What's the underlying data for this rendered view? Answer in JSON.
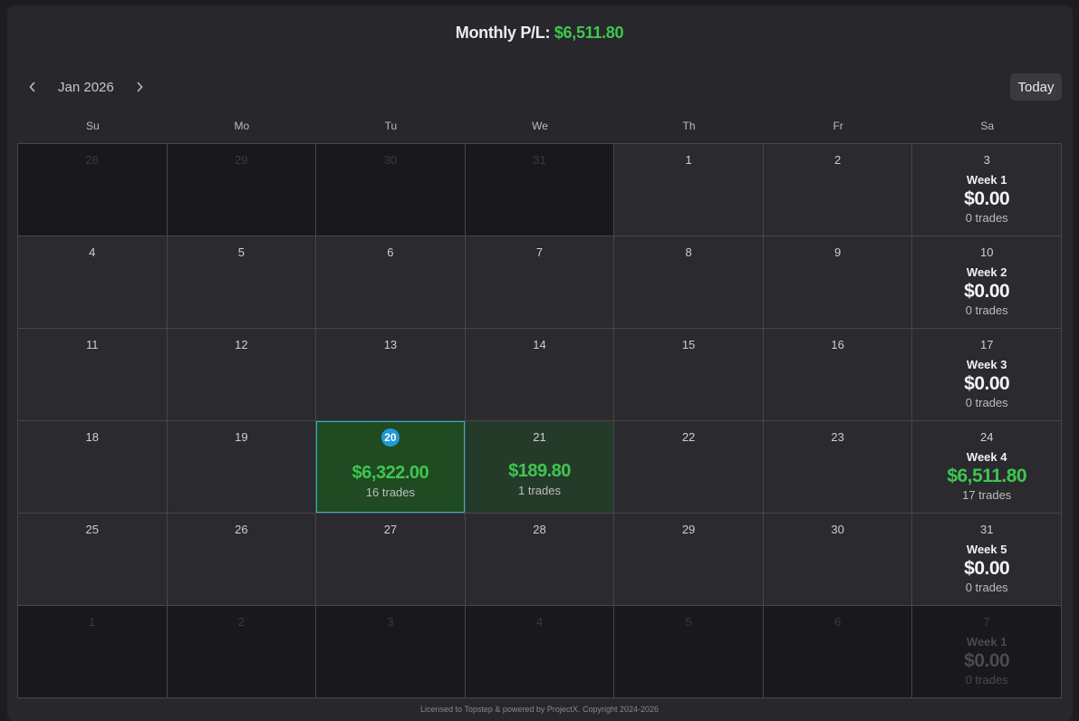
{
  "header": {
    "title_label": "Monthly P/L:",
    "title_amount": "$6,511.80"
  },
  "nav": {
    "prev_icon": "chevron-left-icon",
    "next_icon": "chevron-right-icon",
    "month": "Jan 2026",
    "today_label": "Today"
  },
  "weekdays": [
    "Su",
    "Mo",
    "Tu",
    "We",
    "Th",
    "Fr",
    "Sa"
  ],
  "weeks": [
    {
      "days": [
        {
          "d": "28",
          "outside": true
        },
        {
          "d": "29",
          "outside": true
        },
        {
          "d": "30",
          "outside": true
        },
        {
          "d": "31",
          "outside": true
        },
        {
          "d": "1"
        },
        {
          "d": "2"
        }
      ],
      "summary": {
        "d": "3",
        "label": "Week 1",
        "amount": "$0.00",
        "trades": "0 trades"
      }
    },
    {
      "days": [
        {
          "d": "4"
        },
        {
          "d": "5"
        },
        {
          "d": "6"
        },
        {
          "d": "7"
        },
        {
          "d": "8"
        },
        {
          "d": "9"
        }
      ],
      "summary": {
        "d": "10",
        "label": "Week 2",
        "amount": "$0.00",
        "trades": "0 trades"
      }
    },
    {
      "days": [
        {
          "d": "11"
        },
        {
          "d": "12"
        },
        {
          "d": "13"
        },
        {
          "d": "14"
        },
        {
          "d": "15"
        },
        {
          "d": "16"
        }
      ],
      "summary": {
        "d": "17",
        "label": "Week 3",
        "amount": "$0.00",
        "trades": "0 trades"
      }
    },
    {
      "days": [
        {
          "d": "18"
        },
        {
          "d": "19"
        },
        {
          "d": "20",
          "today": true,
          "pl": "$6,322.00",
          "trades": "16 trades",
          "tone": "green1"
        },
        {
          "d": "21",
          "pl": "$189.80",
          "trades": "1 trades",
          "tone": "green2"
        },
        {
          "d": "22"
        },
        {
          "d": "23"
        }
      ],
      "summary": {
        "d": "24",
        "label": "Week 4",
        "amount": "$6,511.80",
        "trades": "17 trades",
        "positive": true
      }
    },
    {
      "days": [
        {
          "d": "25"
        },
        {
          "d": "26"
        },
        {
          "d": "27"
        },
        {
          "d": "28"
        },
        {
          "d": "29"
        },
        {
          "d": "30"
        }
      ],
      "summary": {
        "d": "31",
        "label": "Week 5",
        "amount": "$0.00",
        "trades": "0 trades"
      }
    },
    {
      "days": [
        {
          "d": "1",
          "outside": true
        },
        {
          "d": "2",
          "outside": true
        },
        {
          "d": "3",
          "outside": true
        },
        {
          "d": "4",
          "outside": true
        },
        {
          "d": "5",
          "outside": true
        },
        {
          "d": "6",
          "outside": true
        }
      ],
      "summary": {
        "d": "7",
        "label": "Week 1",
        "amount": "$0.00",
        "trades": "0 trades",
        "outside": true
      }
    }
  ],
  "footer": {
    "text": "Licensed to Topstep & powered by ProjectX. Copyright 2024-2026"
  },
  "colors": {
    "positive": "#3fc64f",
    "today_badge": "#1e9ad8",
    "selected_outline": "#2fb5c8"
  }
}
